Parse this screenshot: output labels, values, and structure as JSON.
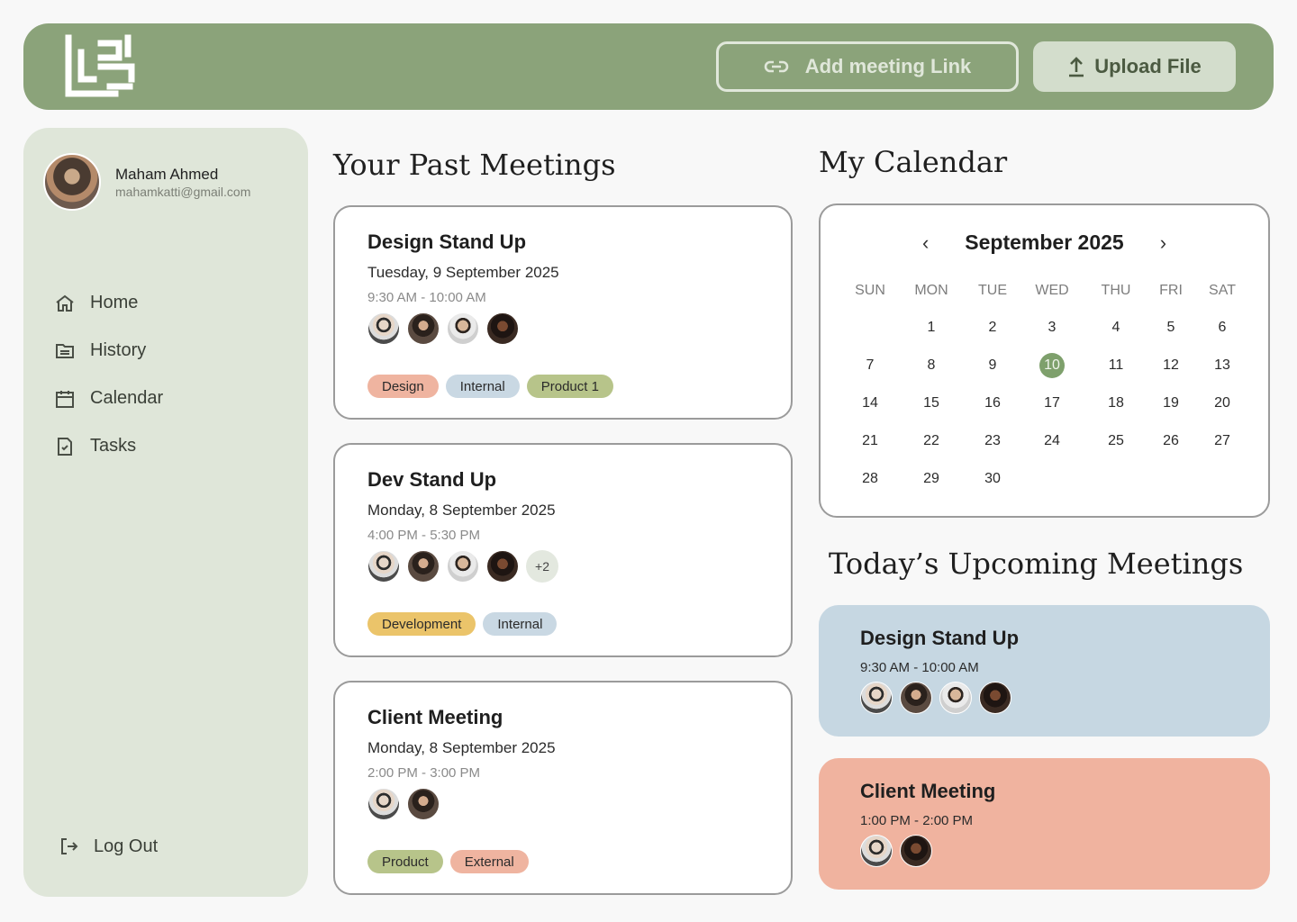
{
  "header": {
    "logo_text": "حرف حرف",
    "add_link_label": "Add meeting Link",
    "upload_label": "Upload File"
  },
  "user": {
    "name": "Maham Ahmed",
    "email": "mahamkatti@gmail.com"
  },
  "nav": [
    {
      "label": "Home",
      "icon": "home-icon"
    },
    {
      "label": "History",
      "icon": "folder-icon"
    },
    {
      "label": "Calendar",
      "icon": "calendar-icon"
    },
    {
      "label": "Tasks",
      "icon": "task-file-icon"
    }
  ],
  "logout_label": "Log Out",
  "past": {
    "title": "Your Past Meetings",
    "meetings": [
      {
        "title": "Design Stand Up",
        "date": "Tuesday, 9 September 2025",
        "time": "9:30 AM - 10:00 AM",
        "tags": [
          {
            "label": "Design",
            "color": "#efb4a0"
          },
          {
            "label": "Internal",
            "color": "#c9d8e3"
          },
          {
            "label": "Product 1",
            "color": "#b7c48a"
          }
        ]
      },
      {
        "title": "Dev Stand Up",
        "date": "Monday, 8 September 2025",
        "time": "4:00 PM - 5:30 PM",
        "more": "+2",
        "tags": [
          {
            "label": "Development",
            "color": "#ebc46a"
          },
          {
            "label": "Internal",
            "color": "#c9d8e3"
          }
        ]
      },
      {
        "title": "Client Meeting",
        "date": "Monday, 8 September 2025",
        "time": "2:00 PM - 3:00 PM",
        "tags": [
          {
            "label": "Product",
            "color": "#b7c48a"
          },
          {
            "label": "External",
            "color": "#efb4a0"
          }
        ]
      }
    ]
  },
  "calendar": {
    "title": "My Calendar",
    "month": "September 2025",
    "prev": "‹",
    "next": "›",
    "weekdays": [
      "SUN",
      "MON",
      "TUE",
      "WED",
      "THU",
      "FRI",
      "SAT"
    ],
    "today": "10",
    "weeks": [
      [
        "",
        "1",
        "2",
        "3",
        "4",
        "5",
        "6"
      ],
      [
        "7",
        "8",
        "9",
        "10",
        "11",
        "12",
        "13"
      ],
      [
        "14",
        "15",
        "16",
        "17",
        "18",
        "19",
        "20"
      ],
      [
        "21",
        "22",
        "23",
        "24",
        "25",
        "26",
        "27"
      ],
      [
        "28",
        "29",
        "30",
        "",
        "",
        "",
        ""
      ]
    ],
    "today_color": "#7ea06c"
  },
  "upcoming": {
    "title": "Today’s Upcoming Meetings",
    "meetings": [
      {
        "title": "Design Stand Up",
        "time": "9:30 AM - 10:00 AM",
        "color": "#c6d7e2"
      },
      {
        "title": "Client Meeting",
        "time": "1:00 PM - 2:00 PM",
        "color": "#f0b39f"
      }
    ]
  },
  "colors": {
    "brand": "#8ba37a",
    "sidebar": "#dfe6d9"
  }
}
